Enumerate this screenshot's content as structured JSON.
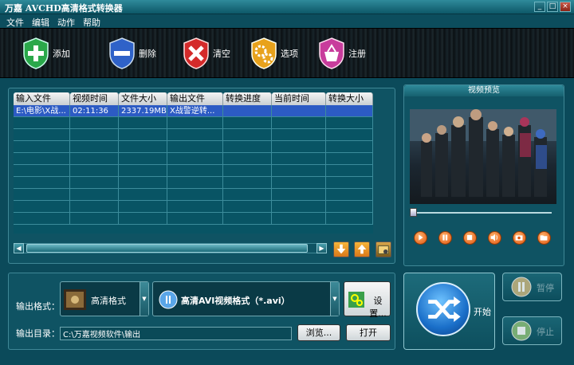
{
  "app": {
    "title": "万嘉 AVCHD高清格式转换器",
    "min": "_",
    "max": "□",
    "close": "×"
  },
  "menu": [
    "文件",
    "编辑",
    "动作",
    "帮助"
  ],
  "toolbar": {
    "add": "添加",
    "delete": "删除",
    "clear": "清空",
    "options": "选项",
    "register": "注册"
  },
  "table": {
    "headers": [
      "输入文件",
      "视频时间",
      "文件大小",
      "输出文件",
      "转换进度",
      "当前时间",
      "转换大小"
    ],
    "rows": [
      [
        "E:\\电影\\X战...",
        "02:11:36",
        "2337.19MB",
        "X战警逆转...",
        "",
        "",
        ""
      ]
    ]
  },
  "preview": {
    "title": "视频预览",
    "progress": 0
  },
  "output": {
    "format_label": "输出格式：",
    "category": "高清格式",
    "format": "高清AVI视频格式（*.avi）",
    "settings": "设置...",
    "dir_label": "输出目录：",
    "dir": "C:\\万嘉视频软件\\输出",
    "browse": "浏览...",
    "open": "打开"
  },
  "actions": {
    "start": "开始",
    "pause": "暂停",
    "stop": "停止"
  },
  "colors": {
    "bg": "#0b4a5a",
    "selected_row": "#2c5bc4"
  }
}
